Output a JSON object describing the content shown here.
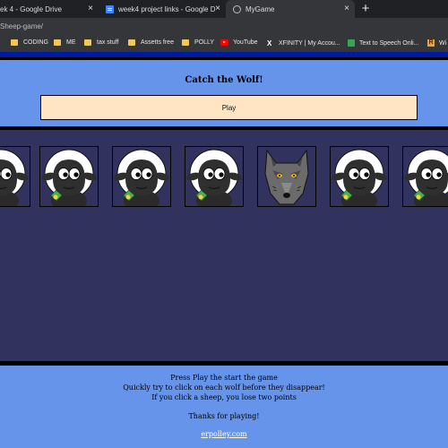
{
  "browser": {
    "tabs": [
      {
        "label": "ek 4 - Google Drive",
        "active": false,
        "icon": "none"
      },
      {
        "label": "week4 project links - Google Do",
        "active": false,
        "icon": "google-docs-icon"
      },
      {
        "label": "MyGame",
        "active": true,
        "icon": "globe-icon"
      }
    ],
    "close_glyph": "×",
    "new_tab_glyph": "+",
    "url": "Sheep-game/",
    "bookmarks": [
      {
        "label": "CODING",
        "icon": "folder-icon"
      },
      {
        "label": "ME",
        "icon": "folder-icon"
      },
      {
        "label": "tax stuff",
        "icon": "folder-icon"
      },
      {
        "label": "Assetts free",
        "icon": "folder-icon"
      },
      {
        "label": "POLLY",
        "icon": "folder-icon"
      },
      {
        "label": "YouTube",
        "icon": "youtube-icon"
      },
      {
        "label": "XFINITY | My Accou...",
        "icon": "xfinity-icon"
      },
      {
        "label": "Text to Speech Onli...",
        "icon": "text-to-speech-icon"
      },
      {
        "label": "Wi",
        "icon": "r-icon"
      }
    ]
  },
  "game": {
    "title": "Catch the Wolf!",
    "play_label": "Play",
    "cards": [
      "sheep",
      "sheep",
      "sheep",
      "sheep",
      "wolf",
      "sheep",
      "sheep"
    ]
  },
  "footer": {
    "line1": "Press Play the start the game",
    "line2": "Quickly try to click on each wolf before they disappear!",
    "line3": "If you click a sheep, you lose two points",
    "thanks": "Thanks for playing!",
    "link": "erpolley.com"
  },
  "colors": {
    "page_blue": "#6594ea",
    "game_bg": "#32325e",
    "play_button": "#ffe5c4",
    "link": "#ffffff"
  }
}
